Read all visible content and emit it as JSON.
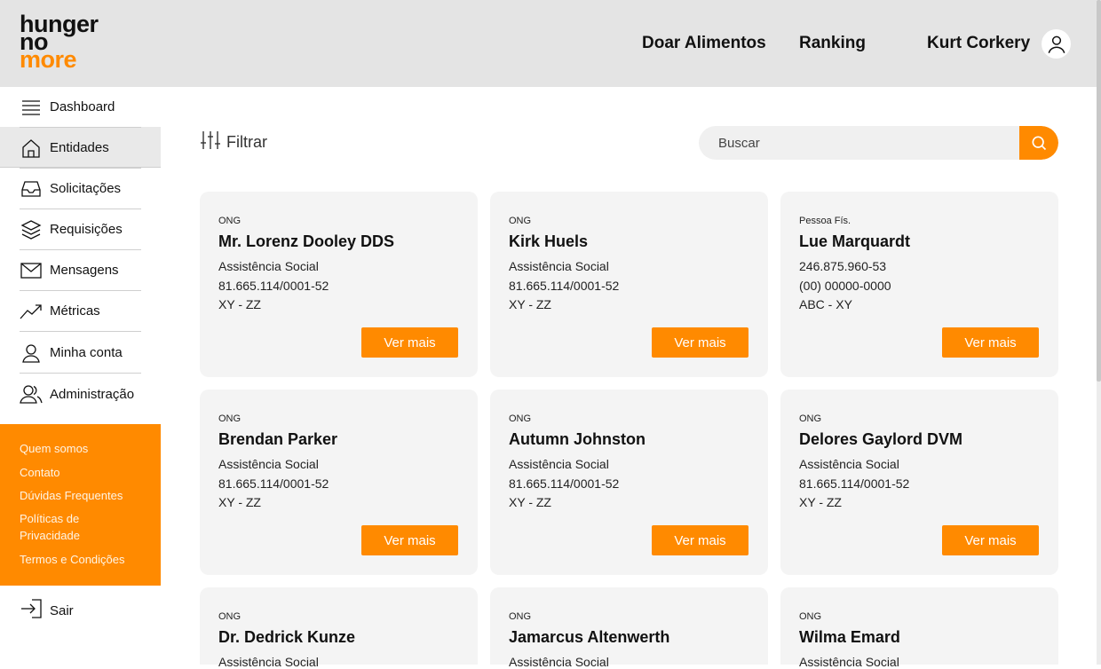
{
  "brand": {
    "line1": "hunger",
    "line2": "no",
    "line3": "more",
    "accent": "#ff8a00"
  },
  "header": {
    "nav": [
      "Doar Alimentos",
      "Ranking"
    ],
    "user_name": "Kurt Corkery"
  },
  "sidebar": {
    "items": [
      {
        "label": "Dashboard",
        "icon": "menu-icon"
      },
      {
        "label": "Entidades",
        "icon": "home-icon",
        "active": true
      },
      {
        "label": "Solicitações",
        "icon": "inbox-icon"
      },
      {
        "label": "Requisições",
        "icon": "layers-icon"
      },
      {
        "label": "Mensagens",
        "icon": "mail-icon"
      },
      {
        "label": "Métricas",
        "icon": "trending-up-icon"
      },
      {
        "label": "Minha conta",
        "icon": "user-icon"
      },
      {
        "label": "Administração",
        "icon": "users-icon"
      }
    ],
    "footer_links": [
      "Quem somos",
      "Contato",
      "Dúvidas Frequentes",
      "Políticas de Privacidade",
      "Termos e Condições"
    ],
    "logout": "Sair"
  },
  "toolbar": {
    "filter_label": "Filtrar",
    "search_placeholder": "Buscar"
  },
  "cards": [
    {
      "type": "ONG",
      "name": "Mr. Lorenz Dooley DDS",
      "l1": "Assistência Social",
      "l2": "81.665.114/0001-52",
      "l3": "XY - ZZ",
      "btn": "Ver mais"
    },
    {
      "type": "ONG",
      "name": "Kirk Huels",
      "l1": "Assistência Social",
      "l2": "81.665.114/0001-52",
      "l3": "XY - ZZ",
      "btn": "Ver mais"
    },
    {
      "type": "Pessoa Fís.",
      "name": "Lue Marquardt",
      "l1": "246.875.960-53",
      "l2": "(00) 00000-0000",
      "l3": "ABC - XY",
      "btn": "Ver mais"
    },
    {
      "type": "ONG",
      "name": "Brendan Parker",
      "l1": "Assistência Social",
      "l2": "81.665.114/0001-52",
      "l3": "XY - ZZ",
      "btn": "Ver mais"
    },
    {
      "type": "ONG",
      "name": "Autumn Johnston",
      "l1": "Assistência Social",
      "l2": "81.665.114/0001-52",
      "l3": "XY - ZZ",
      "btn": "Ver mais"
    },
    {
      "type": "ONG",
      "name": "Delores Gaylord DVM",
      "l1": "Assistência Social",
      "l2": "81.665.114/0001-52",
      "l3": "XY - ZZ",
      "btn": "Ver mais"
    },
    {
      "type": "ONG",
      "name": "Dr. Dedrick Kunze",
      "l1": "Assistência Social"
    },
    {
      "type": "ONG",
      "name": "Jamarcus Altenwerth",
      "l1": "Assistência Social"
    },
    {
      "type": "ONG",
      "name": "Wilma Emard",
      "l1": "Assistência Social"
    }
  ]
}
